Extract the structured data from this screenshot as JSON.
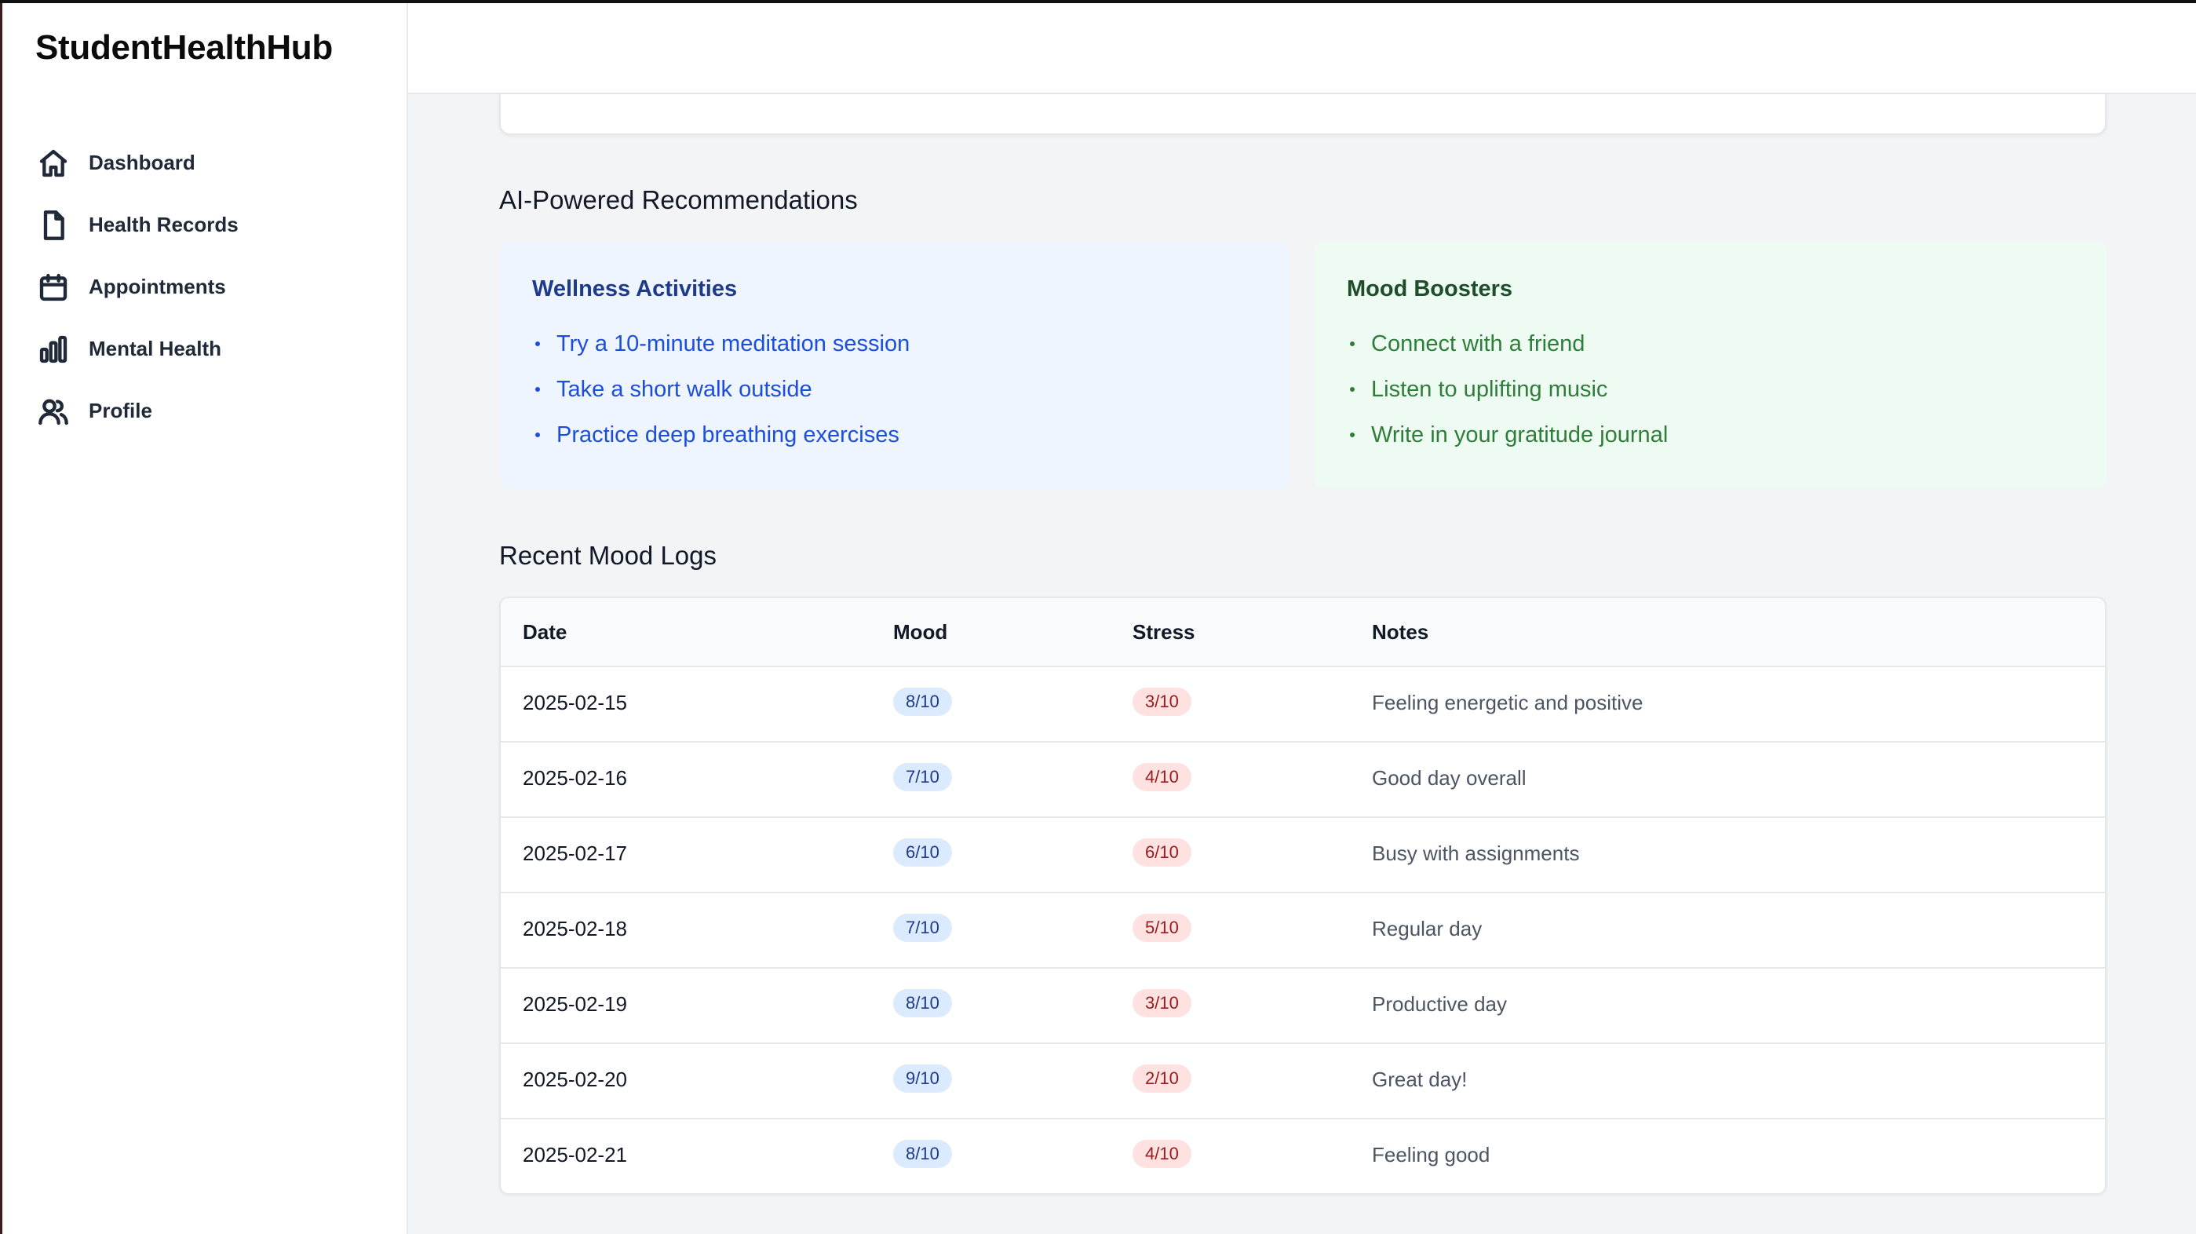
{
  "app": {
    "brand": "StudentHealthHub"
  },
  "sidebar": {
    "items": [
      {
        "label": "Dashboard",
        "icon": "home-icon"
      },
      {
        "label": "Health Records",
        "icon": "document-icon"
      },
      {
        "label": "Appointments",
        "icon": "calendar-icon"
      },
      {
        "label": "Mental Health",
        "icon": "bar-chart-icon"
      },
      {
        "label": "Profile",
        "icon": "users-icon"
      }
    ]
  },
  "recommendations": {
    "title": "AI-Powered Recommendations",
    "wellness": {
      "title": "Wellness Activities",
      "items": [
        "Try a 10-minute meditation session",
        "Take a short walk outside",
        "Practice deep breathing exercises"
      ]
    },
    "mood_boosters": {
      "title": "Mood Boosters",
      "items": [
        "Connect with a friend",
        "Listen to uplifting music",
        "Write in your gratitude journal"
      ]
    }
  },
  "mood_logs": {
    "title": "Recent Mood Logs",
    "columns": [
      "Date",
      "Mood",
      "Stress",
      "Notes"
    ],
    "rows": [
      {
        "date": "2025-02-15",
        "mood": "8/10",
        "stress": "3/10",
        "notes": "Feeling energetic and positive"
      },
      {
        "date": "2025-02-16",
        "mood": "7/10",
        "stress": "4/10",
        "notes": "Good day overall"
      },
      {
        "date": "2025-02-17",
        "mood": "6/10",
        "stress": "6/10",
        "notes": "Busy with assignments"
      },
      {
        "date": "2025-02-18",
        "mood": "7/10",
        "stress": "5/10",
        "notes": "Regular day"
      },
      {
        "date": "2025-02-19",
        "mood": "8/10",
        "stress": "3/10",
        "notes": "Productive day"
      },
      {
        "date": "2025-02-20",
        "mood": "9/10",
        "stress": "2/10",
        "notes": "Great day!"
      },
      {
        "date": "2025-02-21",
        "mood": "8/10",
        "stress": "4/10",
        "notes": "Feeling good"
      }
    ]
  },
  "colors": {
    "accent_blue": "#1d4ed8",
    "accent_green": "#2f7d3a",
    "mood_badge_bg": "#dbeafe",
    "stress_badge_bg": "#fee2e2"
  }
}
